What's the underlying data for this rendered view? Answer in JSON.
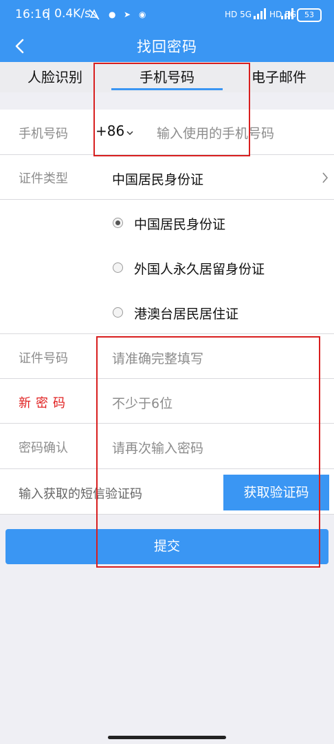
{
  "status_bar": {
    "time": "16:16",
    "speed": "| 0.4K/s",
    "network1": "HD 5G",
    "network2": "HD 5G",
    "battery": "53"
  },
  "nav": {
    "title": "找回密码"
  },
  "tabs": [
    {
      "label": "人脸识别",
      "active": false
    },
    {
      "label": "手机号码",
      "active": true
    },
    {
      "label": "电子邮件",
      "active": false
    }
  ],
  "phone": {
    "label": "手机号码",
    "country_code": "+86",
    "placeholder": "输入使用的手机号码"
  },
  "id_type": {
    "label": "证件类型",
    "selected": "中国居民身份证",
    "options": [
      {
        "label": "中国居民身份证",
        "checked": true
      },
      {
        "label": "外国人永久居留身份证",
        "checked": false
      },
      {
        "label": "港澳台居民居住证",
        "checked": false
      }
    ]
  },
  "id_number": {
    "label": "证件号码",
    "placeholder": "请准确完整填写"
  },
  "new_password": {
    "label": "新密码",
    "placeholder": "不少于6位"
  },
  "confirm_password": {
    "label": "密码确认",
    "placeholder": "请再次输入密码"
  },
  "sms": {
    "label": "输入获取的短信验证码",
    "button": "获取验证码"
  },
  "submit": {
    "label": "提交"
  },
  "colors": {
    "primary": "#3a96f3",
    "annotation": "#d81e1e",
    "required_label": "#e02020"
  }
}
